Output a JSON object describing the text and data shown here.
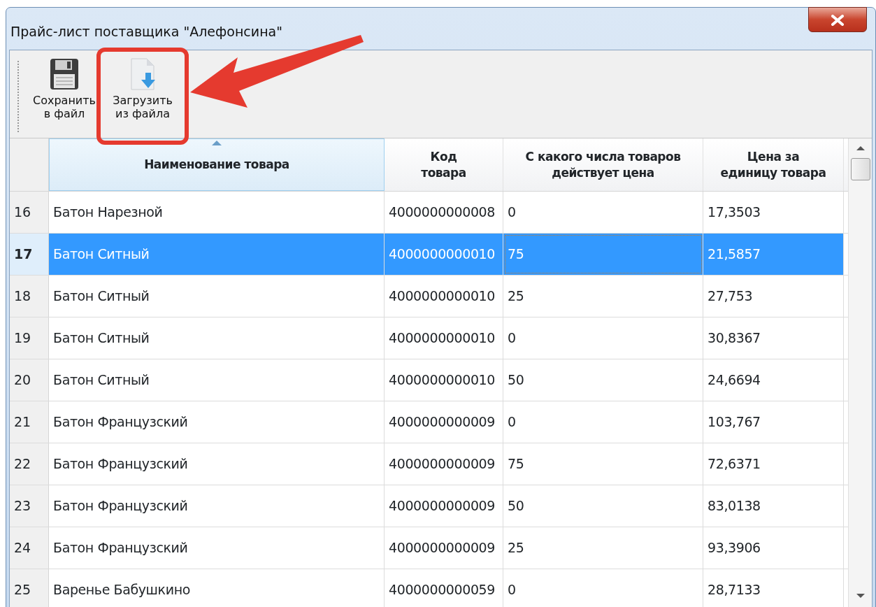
{
  "window": {
    "title": "Прайс-лист поставщика \"Алефонсина\""
  },
  "toolbar": [
    {
      "kind": "save",
      "label": "Сохранить\nв файл",
      "highlighted": false
    },
    {
      "kind": "load",
      "label": "Загрузить\nиз файла",
      "highlighted": true
    }
  ],
  "table": {
    "columns": [
      {
        "label": "Наименование товара",
        "sorted": true
      },
      {
        "label": "Код\nтовара",
        "sorted": false
      },
      {
        "label": "С какого числа товаров\nдействует цена",
        "sorted": false
      },
      {
        "label": "Цена за\nединицу товара",
        "sorted": false
      }
    ],
    "rows": [
      {
        "number": "16",
        "selected": false,
        "cells": [
          {
            "text": "Батон Нарезной",
            "focused": false
          },
          {
            "text": "4000000000008",
            "focused": false
          },
          {
            "text": "0",
            "focused": false
          },
          {
            "text": "17,3503",
            "focused": false
          }
        ]
      },
      {
        "number": "17",
        "selected": true,
        "cells": [
          {
            "text": "Батон Ситный",
            "focused": false
          },
          {
            "text": "4000000000010",
            "focused": false
          },
          {
            "text": "75",
            "focused": true
          },
          {
            "text": "21,5857",
            "focused": false
          }
        ]
      },
      {
        "number": "18",
        "selected": false,
        "cells": [
          {
            "text": "Батон Ситный",
            "focused": false
          },
          {
            "text": "4000000000010",
            "focused": false
          },
          {
            "text": "25",
            "focused": false
          },
          {
            "text": "27,753",
            "focused": false
          }
        ]
      },
      {
        "number": "19",
        "selected": false,
        "cells": [
          {
            "text": "Батон Ситный",
            "focused": false
          },
          {
            "text": "4000000000010",
            "focused": false
          },
          {
            "text": "0",
            "focused": false
          },
          {
            "text": "30,8367",
            "focused": false
          }
        ]
      },
      {
        "number": "20",
        "selected": false,
        "cells": [
          {
            "text": "Батон Ситный",
            "focused": false
          },
          {
            "text": "4000000000010",
            "focused": false
          },
          {
            "text": "50",
            "focused": false
          },
          {
            "text": "24,6694",
            "focused": false
          }
        ]
      },
      {
        "number": "21",
        "selected": false,
        "cells": [
          {
            "text": "Батон Французский",
            "focused": false
          },
          {
            "text": "4000000000009",
            "focused": false
          },
          {
            "text": "0",
            "focused": false
          },
          {
            "text": "103,767",
            "focused": false
          }
        ]
      },
      {
        "number": "22",
        "selected": false,
        "cells": [
          {
            "text": "Батон Французский",
            "focused": false
          },
          {
            "text": "4000000000009",
            "focused": false
          },
          {
            "text": "75",
            "focused": false
          },
          {
            "text": "72,6371",
            "focused": false
          }
        ]
      },
      {
        "number": "23",
        "selected": false,
        "cells": [
          {
            "text": "Батон Французский",
            "focused": false
          },
          {
            "text": "4000000000009",
            "focused": false
          },
          {
            "text": "50",
            "focused": false
          },
          {
            "text": "83,0138",
            "focused": false
          }
        ]
      },
      {
        "number": "24",
        "selected": false,
        "cells": [
          {
            "text": "Батон Французский",
            "focused": false
          },
          {
            "text": "4000000000009",
            "focused": false
          },
          {
            "text": "25",
            "focused": false
          },
          {
            "text": "93,3906",
            "focused": false
          }
        ]
      },
      {
        "number": "25",
        "selected": false,
        "cells": [
          {
            "text": "Варенье Бабушкино",
            "focused": false
          },
          {
            "text": "4000000000059",
            "focused": false
          },
          {
            "text": "0",
            "focused": false
          },
          {
            "text": "28,7133",
            "focused": false
          }
        ]
      }
    ]
  }
}
